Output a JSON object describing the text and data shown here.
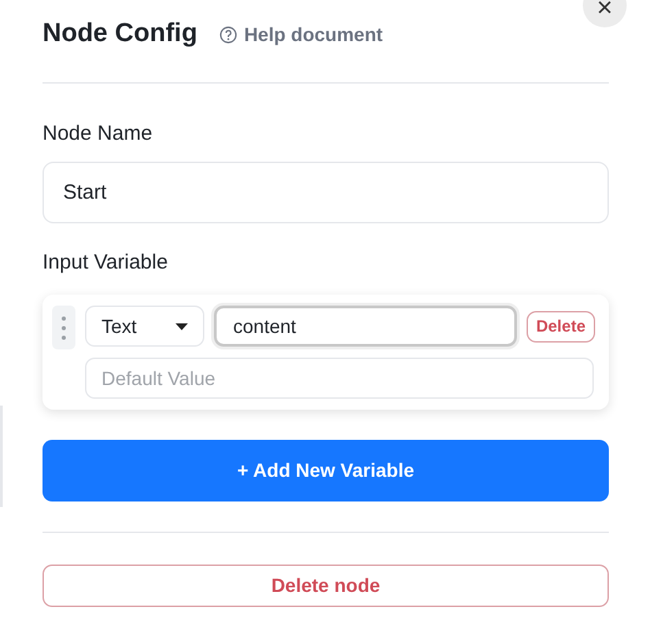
{
  "header": {
    "title": "Node Config",
    "help_link": "Help document",
    "close": "×"
  },
  "node_name": {
    "label": "Node Name",
    "value": "Start"
  },
  "input_variable": {
    "label": "Input Variable",
    "variables": [
      {
        "type": "Text",
        "name": "content",
        "name_focused": true,
        "delete": "Delete",
        "default_placeholder": "Default Value"
      }
    ],
    "add_button": "+ Add New Variable"
  },
  "delete_node": "Delete node"
}
